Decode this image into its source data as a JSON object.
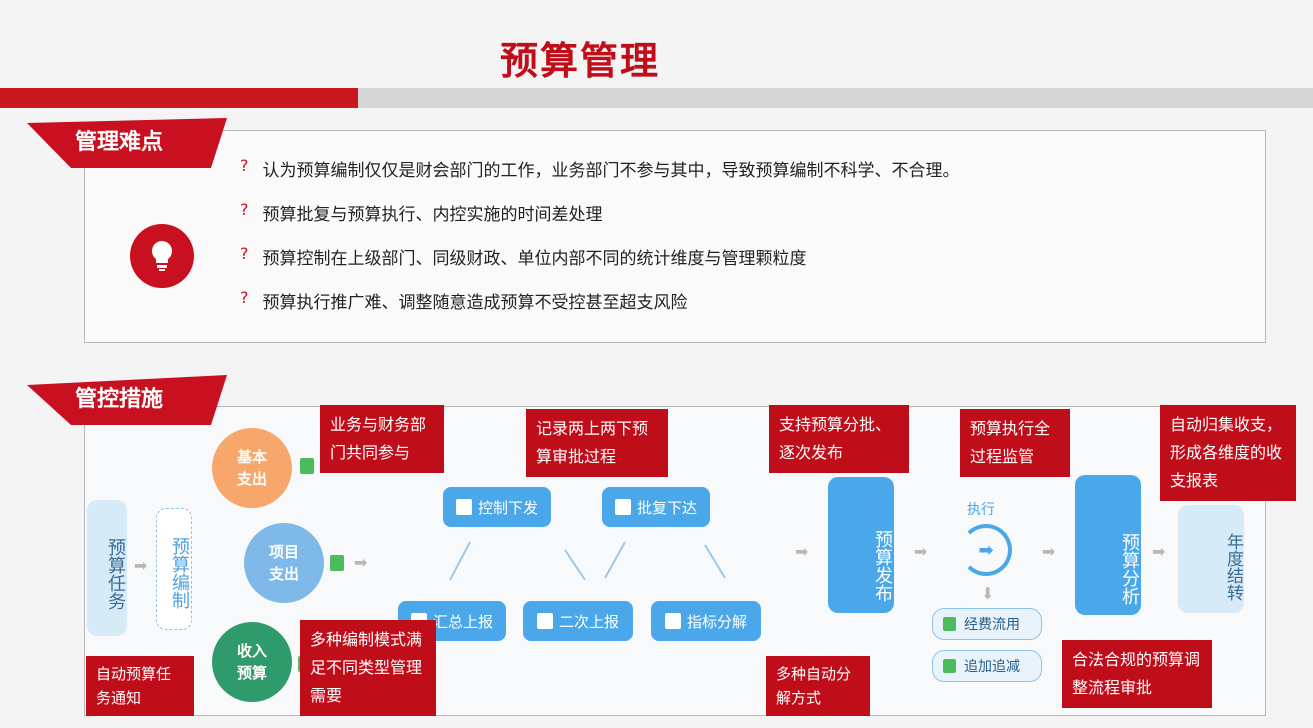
{
  "title": "预算管理",
  "section1": {
    "tag": "管理难点",
    "bullet": "?",
    "points": [
      "认为预算编制仅仅是财会部门的工作，业务部门不参与其中，导致预算编制不科学、不合理。",
      "预算批复与预算执行、内控实施的时间差处理",
      "预算控制在上级部门、同级财政、单位内部不同的统计维度与管理颗粒度",
      "预算执行推广难、调整随意造成预算不受控甚至超支风险"
    ]
  },
  "section2": {
    "tag": "管控措施",
    "task": "预算任务",
    "compile": "预算编制",
    "circles": [
      "基本支出",
      "项目支出",
      "收入预算"
    ],
    "buttons": {
      "control": "控制下发",
      "approve": "批复下达",
      "summary": "汇总上报",
      "second": "二次上报",
      "decompose": "指标分解"
    },
    "release": "预算发布",
    "exec_label": "执行",
    "pills": [
      "经费流用",
      "追加追减"
    ],
    "analysis": "预算分析",
    "year": "年度结转",
    "callouts": {
      "c1": "业务与财务部门共同参与",
      "c2": "记录两上两下预算审批过程",
      "c3": "支持预算分批、逐次发布",
      "c4": "预算执行全过程监管",
      "c5": "自动归集收支，形成各维度的收支报表",
      "c6": "自动预算任务通知",
      "c7": "多种编制模式满足不同类型管理需要",
      "c8": "多种自动分解方式",
      "c9": "合法合规的预算调整流程审批"
    }
  },
  "colors": {
    "accent": "#c00d1a",
    "blue": "#4aa8ea"
  }
}
